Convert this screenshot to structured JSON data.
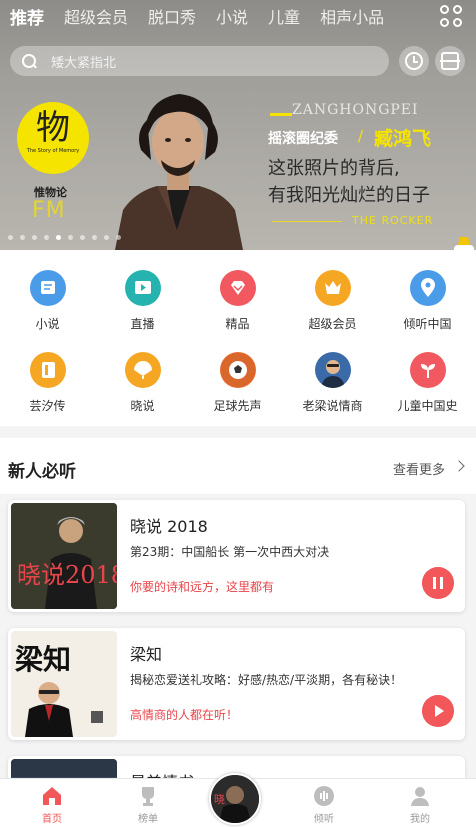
{
  "header": {
    "tabs": [
      {
        "label": "推荐",
        "active": true
      },
      {
        "label": "超级会员",
        "active": false
      },
      {
        "label": "脱口秀",
        "active": false
      },
      {
        "label": "小说",
        "active": false
      },
      {
        "label": "儿童",
        "active": false
      },
      {
        "label": "相声小品",
        "active": false
      }
    ],
    "grid_icon": "four-circles-icon"
  },
  "search": {
    "placeholder": "矮大紧指北",
    "history_icon": "clock-icon",
    "scan_icon": "scan-icon"
  },
  "banner": {
    "logo_char": "物",
    "logo_subtitle": "The Story of Memory",
    "logo_name": "惟物论",
    "fm": "FM",
    "top_text": "ZANGHONGPEI",
    "tagline": "摇滚圈纪委",
    "slash": "/",
    "name": "臧鸿飞",
    "line1": "这张照片的背后,",
    "line2": "有我阳光灿烂的日子",
    "sign": "THE ROCKER",
    "slide_count": 10,
    "active_slide": 4
  },
  "quick_entries": [
    {
      "label": "小说",
      "icon": "book-icon",
      "color": "#4a9be8"
    },
    {
      "label": "直播",
      "icon": "live-play-icon",
      "color": "#26b3b0"
    },
    {
      "label": "精品",
      "icon": "diamond-icon",
      "color": "#f1585f"
    },
    {
      "label": "超级会员",
      "icon": "crown-icon",
      "color": "#f5a623"
    },
    {
      "label": "倾听中国",
      "icon": "location-pin-icon",
      "color": "#4a9be8"
    },
    {
      "label": "芸汐传",
      "icon": "document-icon",
      "color": "#f5a623"
    },
    {
      "label": "晓说",
      "icon": "fan-icon",
      "color": "#f5a623"
    },
    {
      "label": "足球先声",
      "icon": "football-icon",
      "color": "#e86a2b"
    },
    {
      "label": "老梁说情商",
      "icon": "avatar-icon",
      "color": "#3b6aa8"
    },
    {
      "label": "儿童中国史",
      "icon": "sprout-icon",
      "color": "#f1585f"
    }
  ],
  "section": {
    "title": "新人必听",
    "more": "查看更多",
    "cards": [
      {
        "title": "晓说 2018",
        "desc": "第23期：中国船长 第一次中西大对决",
        "tip": "你要的诗和远方，这里都有",
        "state": "pause",
        "cover_text": "晓说2018"
      },
      {
        "title": "梁知",
        "desc": "揭秘恋爱送礼攻略：好感/热恋/平淡期，各有秘诀！",
        "tip": "高情商的人都在听！",
        "state": "play",
        "cover_text": "梁知"
      },
      {
        "title": "最美情书",
        "desc": "",
        "tip": "",
        "state": "play",
        "cover_text": ""
      }
    ]
  },
  "bottom_nav": [
    {
      "label": "首页",
      "icon": "home-icon",
      "active": true
    },
    {
      "label": "榜单",
      "icon": "trophy-icon",
      "active": false
    },
    {
      "label": "",
      "icon": "now-playing-icon",
      "active": false
    },
    {
      "label": "倾听",
      "icon": "audio-wave-icon",
      "active": false
    },
    {
      "label": "我的",
      "icon": "person-icon",
      "active": false
    }
  ],
  "colors": {
    "accent": "#f2585a",
    "banner_yellow": "#f5e400",
    "tip_red": "#e8464b"
  }
}
